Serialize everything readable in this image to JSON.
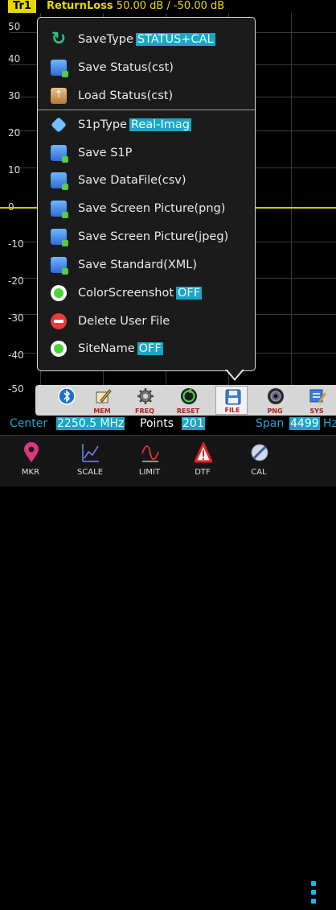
{
  "title_bar": {
    "trace": "Tr1",
    "measurement": "ReturnLoss",
    "scale": "50.00 dB / -50.00 dB"
  },
  "y_axis": [
    "50",
    "40",
    "30",
    "20",
    "10",
    "0",
    "-10",
    "-20",
    "-30",
    "-40",
    "-50"
  ],
  "menu": {
    "items": [
      {
        "label": "SaveType",
        "value": "STATUS+CAL",
        "icon": "sync-icon"
      },
      {
        "label": "Save Status(cst)",
        "icon": "save-disk-icon"
      },
      {
        "label": "Load Status(cst)",
        "icon": "load-box-icon"
      },
      {
        "label": "S1pType",
        "value": "Real-Imag",
        "icon": "diamond-icon"
      },
      {
        "label": "Save S1P",
        "icon": "save-disk-icon"
      },
      {
        "label": "Save DataFile(csv)",
        "icon": "save-disk-icon"
      },
      {
        "label": "Save Screen Picture(png)",
        "icon": "save-disk-icon"
      },
      {
        "label": "Save Screen Picture(jpeg)",
        "icon": "save-disk-icon"
      },
      {
        "label": "Save Standard(XML)",
        "icon": "save-disk-icon"
      },
      {
        "label": "ColorScreenshot",
        "value": "OFF",
        "icon": "green-toggle-icon"
      },
      {
        "label": "Delete User File",
        "icon": "red-minus-icon"
      },
      {
        "label": "SiteName",
        "value": "OFF",
        "icon": "green-toggle-icon"
      }
    ]
  },
  "toolbar": {
    "items": [
      {
        "label": "",
        "icon": "bluetooth-icon"
      },
      {
        "label": "MEM",
        "icon": "pen-icon"
      },
      {
        "label": "FREQ",
        "icon": "gear-icon"
      },
      {
        "label": "RESET",
        "icon": "reset-icon"
      },
      {
        "label": "FILE",
        "icon": "file-floppy-icon"
      },
      {
        "label": "PNG",
        "icon": "camera-icon"
      },
      {
        "label": "SYS",
        "icon": "settings-icon"
      }
    ]
  },
  "info": {
    "center_label": "Center",
    "center_value": "2250.5 MHz",
    "points_label": "Points",
    "points_value": "201",
    "span_label": "Span",
    "span_value": "4499",
    "span_unit": "Hz"
  },
  "nav": {
    "items": [
      {
        "label": "MKR",
        "icon": "marker-pin-icon"
      },
      {
        "label": "SCALE",
        "icon": "scale-icon"
      },
      {
        "label": "LIMIT",
        "icon": "limit-icon"
      },
      {
        "label": "DTF",
        "icon": "warning-icon"
      },
      {
        "label": "CAL",
        "icon": "cal-icon"
      }
    ]
  },
  "colors": {
    "accent": "#19a7c6",
    "trace": "#d8c400",
    "title": "#e8d800"
  }
}
